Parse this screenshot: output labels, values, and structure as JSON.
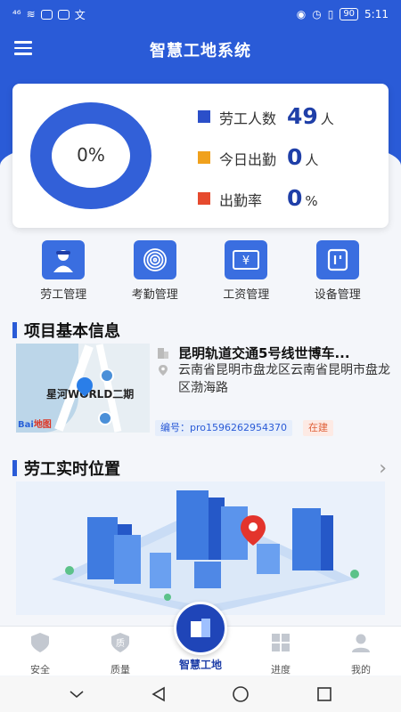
{
  "status_bar": {
    "signal": "⁴⁶",
    "time": "5:11",
    "battery": "90"
  },
  "header": {
    "title": "智慧工地系统"
  },
  "stats": {
    "donut_label": "0%",
    "attendance_fraction": 0,
    "rows": [
      {
        "label": "劳工人数",
        "value": "49",
        "unit": "人",
        "color": "#2b4fc9"
      },
      {
        "label": "今日出勤",
        "value": "0",
        "unit": "人",
        "color": "#f0a11c"
      },
      {
        "label": "出勤率",
        "value": "0",
        "unit": "%",
        "color": "#e64a2e"
      }
    ]
  },
  "quick_actions": [
    {
      "label": "劳工管理",
      "icon": "worker-icon"
    },
    {
      "label": "考勤管理",
      "icon": "fingerprint-icon"
    },
    {
      "label": "工资管理",
      "icon": "salary-icon"
    },
    {
      "label": "设备管理",
      "icon": "device-icon"
    }
  ],
  "project_section": {
    "title": "项目基本信息",
    "name": "昆明轨道交通5号线世博车...",
    "address": "云南省昆明市盘龙区云南省昆明市盘龙区渤海路",
    "code": "编号：pro1596262954370",
    "status": "在建",
    "map_label": "星河WORLD二期",
    "map_brand": "Bai",
    "map_brand2": "地图"
  },
  "location_section": {
    "title": "劳工实时位置"
  },
  "bottom_nav": {
    "items": [
      {
        "label": "安全",
        "icon": "shield-icon"
      },
      {
        "label": "质量",
        "icon": "quality-icon"
      },
      {
        "label": "智慧工地",
        "icon": "smart-site-icon"
      },
      {
        "label": "进度",
        "icon": "progress-icon"
      },
      {
        "label": "我的",
        "icon": "user-icon"
      }
    ]
  },
  "colors": {
    "primary": "#2a5bd7",
    "accent_orange": "#f0a11c",
    "accent_red": "#e64a2e"
  }
}
